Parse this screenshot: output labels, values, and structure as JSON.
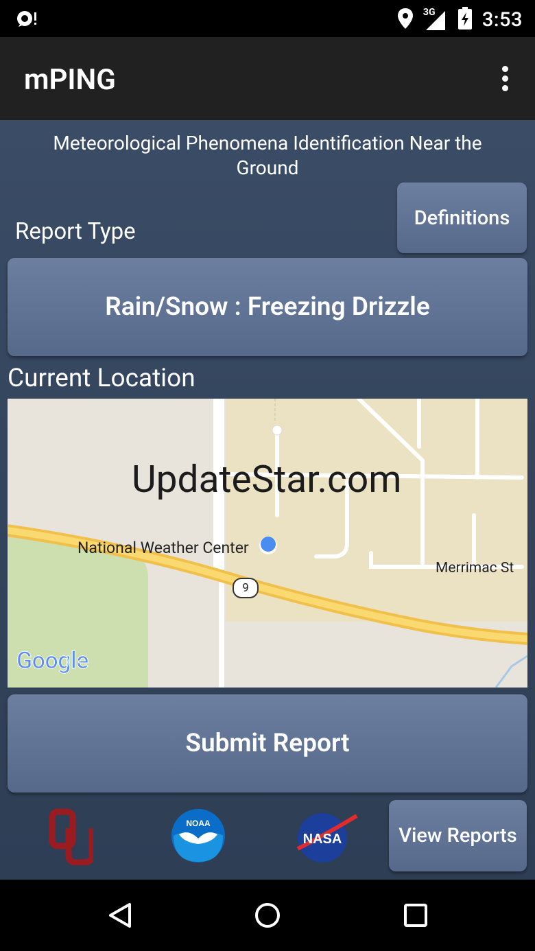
{
  "status_bar": {
    "network": "3G",
    "time": "3:53"
  },
  "app_bar": {
    "title": "mPING"
  },
  "main": {
    "subtitle": "Meteorological Phenomena Identification Near the Ground",
    "definitions_label": "Definitions",
    "report_type_label": "Report Type",
    "report_type_value": "Rain/Snow : Freezing Drizzle",
    "current_location_label": "Current Location",
    "map": {
      "watermark": "UpdateStar.com",
      "place_label": "National Weather Center",
      "street_label": "Merrimac St",
      "route_number": "9",
      "attribution": "Google"
    },
    "submit_label": "Submit Report",
    "view_reports_label": "View Reports"
  },
  "footer_logos": [
    "ou-logo",
    "noaa-logo",
    "nasa-logo"
  ],
  "colors": {
    "accent": "#4285f4",
    "button": "#5f7293",
    "background": "#35465f"
  }
}
